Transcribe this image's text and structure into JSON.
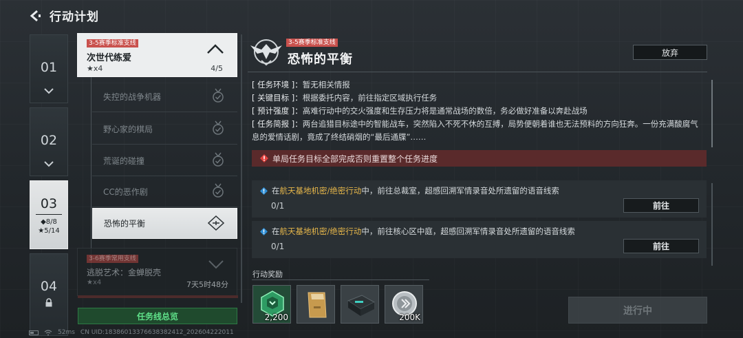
{
  "header": {
    "title": "行动计划"
  },
  "chapters": [
    {
      "num": "01"
    },
    {
      "num": "02"
    },
    {
      "num": "03",
      "diamond": "◆8/8",
      "stars": "★5/14"
    },
    {
      "num": "04"
    }
  ],
  "quest": {
    "tag": "3-5赛季标准支线",
    "name": "次世代练爱",
    "stars": "★x4",
    "progress": "4/5",
    "subs": [
      "失控的战争机器",
      "野心家的棋局",
      "荒诞的碰撞",
      "CC的恶作剧",
      "恐怖的平衡"
    ]
  },
  "next_quest": {
    "tag": "3-6赛季常用支线",
    "name": "逃脱艺术：金蝉脱壳",
    "stars": "★x4",
    "time": "7天5时48分"
  },
  "overview_button": "任务线总览",
  "detail": {
    "tag": "3-5赛季标准支线",
    "title": "恐怖的平衡",
    "abandon": "放弃",
    "info": [
      {
        "k": "[ 任务环境 ]：",
        "v": "暂无相关情报"
      },
      {
        "k": "[ 关键目标 ]：",
        "v": "根据委托内容，前往指定区域执行任务"
      },
      {
        "k": "[ 预计强度 ]：",
        "v": "高难行动中的交火强度和生存压力将是通常战场的数倍，务必做好准备以奔赴战场"
      },
      {
        "k": "[ 任务简报 ]：",
        "v": "两台追猎目标途中的智能战车，突然陷入不死不休的互搏，局势便朝着谁也无法预料的方向狂奔。一份充满酸腐气息的爱情话剧，竟成了终结硝烟的“最后通牒”……"
      }
    ],
    "warning": "单局任务目标全部完成否则重置整个任务进度",
    "tasks": [
      {
        "pre": "在",
        "hl": "航天基地机密/绝密行动",
        "post": "中，前往总裁室，超感回溯军情录音处所遗留的语音线索",
        "progress": "0/1",
        "button": "前往"
      },
      {
        "pre": "在",
        "hl": "航天基地机密/绝密行动",
        "post": "中，前往核心区中庭，超感回溯军情录音处所遗留的语音线索",
        "progress": "0/1",
        "button": "前往"
      }
    ],
    "reward_label": "行动奖励",
    "rewards": [
      {
        "icon": "green-medal-icon",
        "amount": "2,200"
      },
      {
        "icon": "document-folder-icon",
        "amount": ""
      },
      {
        "icon": "hardware-case-icon",
        "amount": ""
      },
      {
        "icon": "silver-coin-icon",
        "amount": "200K"
      }
    ],
    "status_button": "进行中"
  },
  "statusbar": {
    "ping": "52ms",
    "uid": "CN UID:18386013376638382412_202604222011"
  },
  "colors": {
    "accent_red": "#c9514d",
    "green": "#5fe089",
    "highlight": "#e4b54a"
  }
}
